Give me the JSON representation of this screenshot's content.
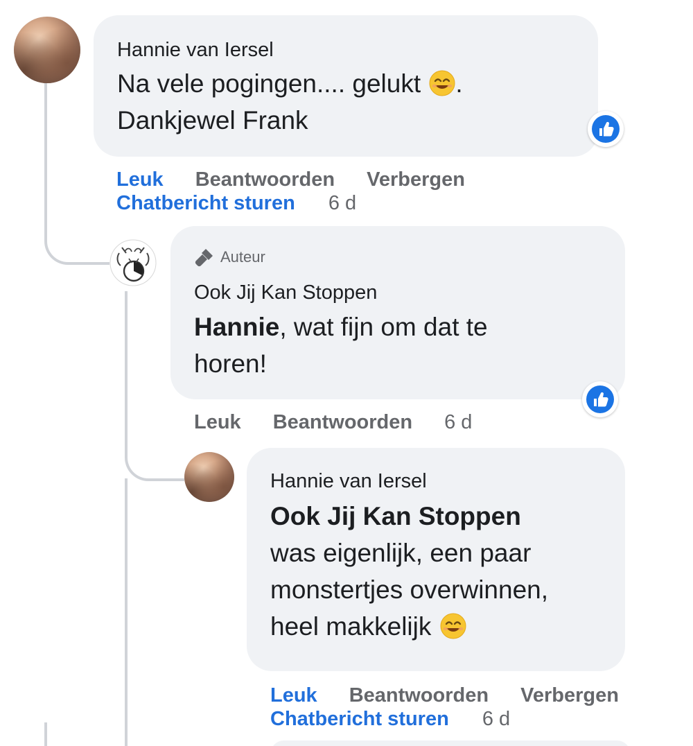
{
  "comments": [
    {
      "author": "Hannie van Iersel",
      "text_line1": "Na vele pogingen.... gelukt",
      "text_line1_end": ".",
      "text_line2": "Dankjewel Frank",
      "actions": {
        "like": "Leuk",
        "reply": "Beantwoorden",
        "hide": "Verbergen",
        "message": "Chatbericht sturen",
        "time": "6 d"
      }
    },
    {
      "badge": "Auteur",
      "author": "Ook Jij Kan Stoppen",
      "mention": "Hannie",
      "text_line1_rest": ", wat fijn om dat te",
      "text_line2": "horen!",
      "actions": {
        "like": "Leuk",
        "reply": "Beantwoorden",
        "time": "6 d"
      }
    },
    {
      "author": "Hannie van Iersel",
      "mention": "Ook Jij Kan Stoppen",
      "text_line2": "was eigenlijk, een paar",
      "text_line3": "monstertjes overwinnen,",
      "text_line4": "heel makkelijk",
      "actions": {
        "like": "Leuk",
        "reply": "Beantwoorden",
        "hide": "Verbergen",
        "message": "Chatbericht sturen",
        "time": "6 d"
      }
    }
  ],
  "colors": {
    "bubble": "#f0f2f5",
    "like_blue": "#216fdb",
    "muted": "#65676b"
  },
  "icons": [
    "avatar-photo",
    "page-avatar-icon",
    "microphone-icon",
    "like-reaction-icon",
    "smile-emoji-icon"
  ]
}
